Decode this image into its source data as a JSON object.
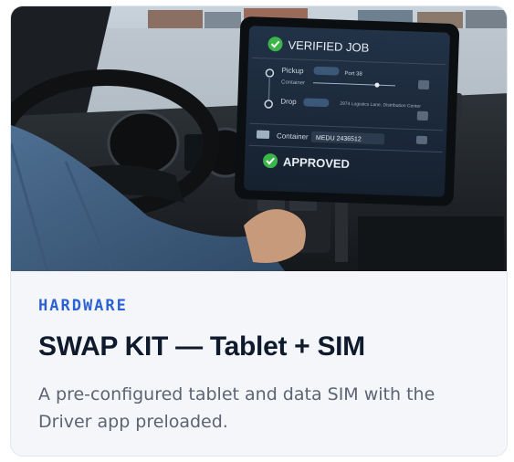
{
  "card": {
    "category": "HARDWARE",
    "title": "SWAP KIT — Tablet + SIM",
    "description": "A pre-configured tablet and data SIM with the Driver app preloaded."
  },
  "tablet": {
    "header": "VERIFIED JOB",
    "pickup_label": "Pickup",
    "container_small": "Container",
    "port_label": "Port 38",
    "drop_label": "Drop",
    "drop_address": "2974 Logistics Lane, Distribution Center",
    "container_label": "Container",
    "container_id": "MEDU 2436512",
    "status": "APPROVED"
  },
  "colors": {
    "accent": "#2b63d6",
    "verified_green": "#3bb54a",
    "screen_bg": "#1c2a3a"
  }
}
